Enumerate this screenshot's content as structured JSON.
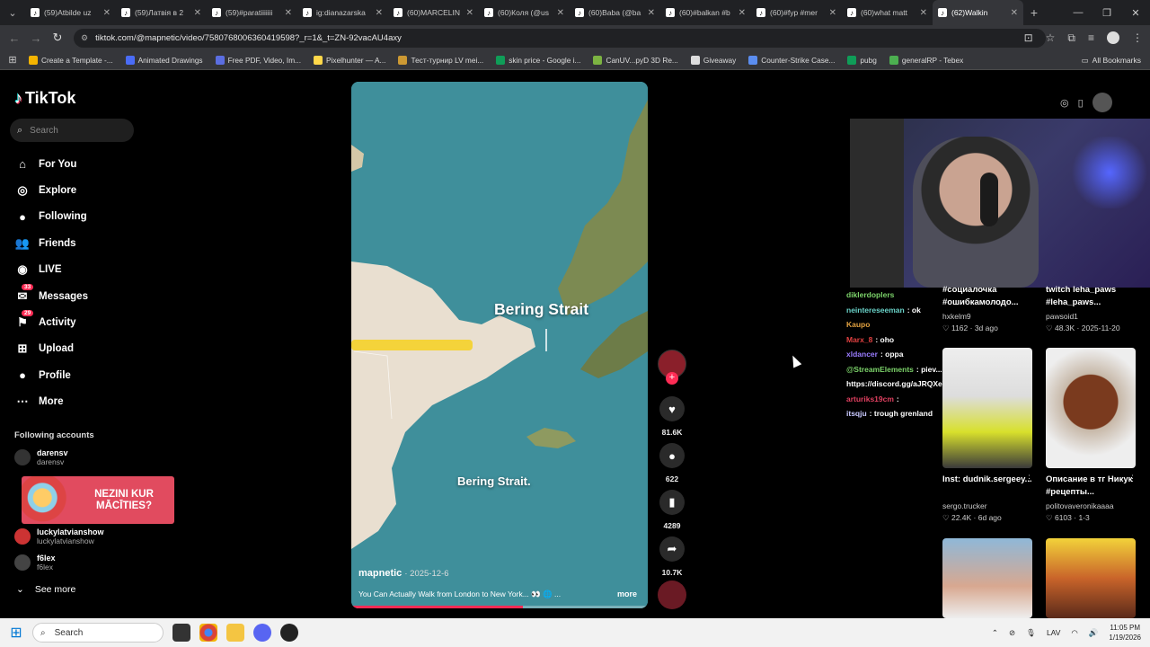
{
  "browser": {
    "tabs": [
      {
        "title": "(59)Atbilde uz"
      },
      {
        "title": "(59)Латвія в 2"
      },
      {
        "title": "(59)#paratiiiiiii"
      },
      {
        "title": "ig:dianazarska"
      },
      {
        "title": "(60)MARCELIN"
      },
      {
        "title": "(60)Коля (@us"
      },
      {
        "title": "(60)Baba (@ba"
      },
      {
        "title": "(60)#balkan #b"
      },
      {
        "title": "(60)#fyp #mer"
      },
      {
        "title": "(60)what matt"
      },
      {
        "title": "(62)Walkin"
      }
    ],
    "url": "tiktok.com/@mapnetic/video/7580768006360419598?_r=1&_t=ZN-92vacAU4axy",
    "bookmarks": [
      {
        "label": "Create a Template -...",
        "color": "#f4b400"
      },
      {
        "label": "Animated Drawings",
        "color": "#4a6cf7"
      },
      {
        "label": "Free PDF, Video, Im...",
        "color": "#5b6ee1"
      },
      {
        "label": "Pixelhunter — A...",
        "color": "#ffd84a"
      },
      {
        "label": "Тест-турнир LV mei...",
        "color": "#c93"
      },
      {
        "label": "skin price - Google i...",
        "color": "#0f9d58"
      },
      {
        "label": "CanUV...pyD 3D Re...",
        "color": "#7cb342"
      },
      {
        "label": "Giveaway",
        "color": "#ddd"
      },
      {
        "label": "Counter-Strike Case...",
        "color": "#5b8def"
      },
      {
        "label": "pubg",
        "color": "#0f9d58"
      },
      {
        "label": "generalRP - Tebex",
        "color": "#4caf50"
      }
    ],
    "all_bookmarks": "All Bookmarks"
  },
  "tiktok": {
    "logo": "TikTok",
    "search_placeholder": "Search",
    "nav": [
      {
        "label": "For You",
        "icon": "home-icon"
      },
      {
        "label": "Explore",
        "icon": "compass-icon"
      },
      {
        "label": "Following",
        "icon": "following-icon"
      },
      {
        "label": "Friends",
        "icon": "friends-icon"
      },
      {
        "label": "LIVE",
        "icon": "live-icon"
      },
      {
        "label": "Messages",
        "icon": "messages-icon",
        "badge": "33"
      },
      {
        "label": "Activity",
        "icon": "activity-icon",
        "badge": "29"
      },
      {
        "label": "Upload",
        "icon": "upload-icon"
      },
      {
        "label": "Profile",
        "icon": "profile-icon"
      },
      {
        "label": "More",
        "icon": "more-icon"
      }
    ],
    "following_title": "Following accounts",
    "accounts": [
      {
        "name": "darensv",
        "handle": "darensv"
      },
      {
        "name": "luckylatvianshow",
        "handle": "luckylatvianshow"
      },
      {
        "name": "f6lex",
        "handle": "f6lex"
      }
    ],
    "see_more": "See more",
    "ad_text": "NEZINI KUR MĀCĪTIES?"
  },
  "video": {
    "label_big": "Bering Strait",
    "label_small": "Bering Strait.",
    "author": "mapnetic",
    "date": "· 2025-12-6",
    "caption": "You Can Actually Walk from London to New York... 👀 🌐 ...",
    "more": "more",
    "progress": 0.58,
    "likes": "81.6K",
    "comments": "622",
    "saves": "4289",
    "shares": "10.7K"
  },
  "chat": [
    {
      "user": "diklerdoplers",
      "text": "",
      "color": "#7cd36a"
    },
    {
      "user": "neintereseeman",
      "text": ": ok",
      "color": "#6ad3c9"
    },
    {
      "user": "Kaupo",
      "text": "",
      "color": "#e0a040"
    },
    {
      "user": "Marx_8",
      "text": ": oho",
      "color": "#e04040"
    },
    {
      "user": "xldancer",
      "text": ": oppa",
      "color": "#9a7cff"
    },
    {
      "user": "@StreamElements",
      "text": ": piev... discord.gg...",
      "color": "#7cd36a"
    },
    {
      "user": "https://discord.gg/aJRQXeV",
      "text": "",
      "color": "#ffffff"
    },
    {
      "user": "arturiks19cm",
      "text": ": ",
      "color": "#e04060"
    },
    {
      "user": "itsqju",
      "text": ": trough grenland",
      "color": "#c9c9ff"
    }
  ],
  "grid": [
    {
      "caption": "#социалочка #ошибкамолодо...",
      "user": "hxkelm9",
      "stats": "♡ 1162 · 3d ago"
    },
    {
      "caption": "twitch leha_paws #leha_paws...",
      "user": "pawsoid1",
      "stats": "♡ 48.3K · 2025-11-20"
    },
    {
      "caption": "Inst: dudnik.sergeey...",
      "user": "sergo.trucker",
      "stats": "♡ 22.4K · 6d ago"
    },
    {
      "caption": "Описание в тг Никук #рецепты...",
      "user": "politovaveronikaaaa",
      "stats": "♡ 6103 · 1-3"
    }
  ],
  "taskbar": {
    "search": "Search",
    "lang": "LAV",
    "time": "11:05 PM",
    "date": "1/19/2026"
  }
}
